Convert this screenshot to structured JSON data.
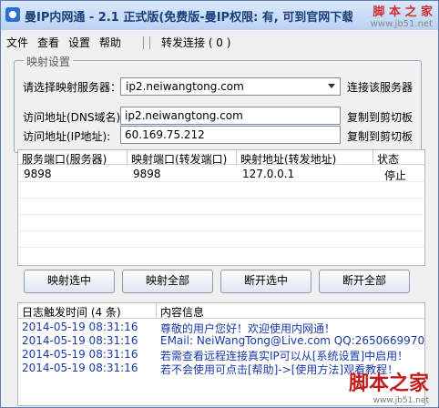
{
  "window": {
    "title": "曼IP内网通 - 2.1 正式版(免费版-曼IP权限: 有, 可到官网下载无..."
  },
  "site_mark": {
    "text": "脚 本 之 家",
    "url": "www.jb51.net"
  },
  "menu": {
    "items": [
      "文件",
      "查看",
      "设置",
      "帮助"
    ],
    "forward": "转发连接 ( 0 )"
  },
  "mapping": {
    "legend": "映射设置",
    "server_label": "请选择映射服务器：",
    "server_value": "ip2.neiwangtong.com",
    "connect_button": "连接该服务器",
    "dns_label": "访问地址(DNS域名):",
    "dns_value": "ip2.neiwangtong.com",
    "ip_label": "访问地址(IP地址):",
    "ip_value": "60.169.75.212",
    "copy_button": "复制到剪切板"
  },
  "table": {
    "headers": [
      "服务端口(服务器)",
      "映射端口(转发端口)",
      "映射地址(转发地址)",
      "状态"
    ],
    "rows": [
      [
        "9898",
        "9898",
        "127.0.0.1",
        "停止"
      ]
    ]
  },
  "buttons": {
    "map_selected": "映射选中",
    "map_all": "映射全部",
    "disconnect_selected": "断开选中",
    "disconnect_all": "断开全部"
  },
  "log": {
    "headers": [
      "日志触发时间 (4 条)",
      "内容信息"
    ],
    "rows": [
      [
        "2014-05-19 08:31:16",
        "尊敬的用户您好！欢迎使用内网通！"
      ],
      [
        "2014-05-19 08:31:16",
        "EMail: NeiWangTong@Live.com QQ:2650669970"
      ],
      [
        "2014-05-19 08:31:16",
        "若需查看远程连接真实IP可以从[系统设置]中启用！"
      ],
      [
        "2014-05-19 08:31:16",
        "若不会使用可点击[帮助]->[使用方法]观看教程！"
      ]
    ]
  },
  "watermark": {
    "text": "脚本之家",
    "url": "www.jb51.net"
  }
}
